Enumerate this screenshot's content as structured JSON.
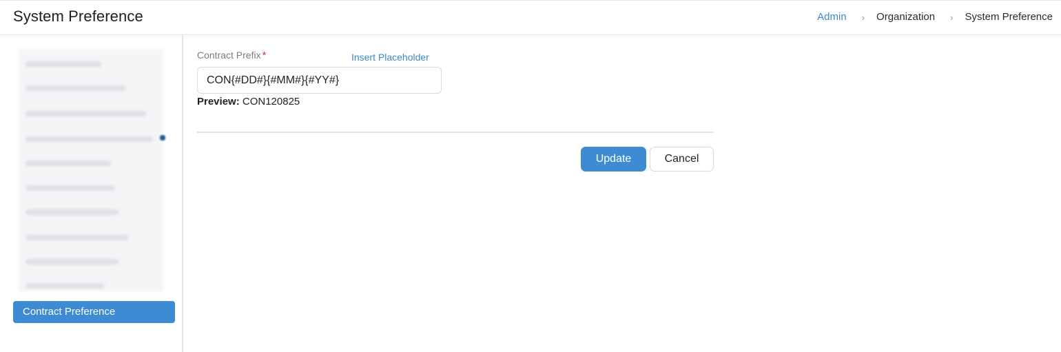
{
  "header": {
    "title": "System Preference",
    "breadcrumb": [
      {
        "label": "Admin"
      },
      {
        "label": "Organization"
      },
      {
        "label": "System Preference"
      }
    ],
    "separator": "›"
  },
  "sidebar": {
    "active_item": "Contract Preference"
  },
  "form": {
    "field_label": "Contract Prefix",
    "required_mark": "*",
    "insert_link": "Insert Placeholder",
    "prefix_value": "CON{#DD#}{#MM#}{#YY#}",
    "preview_label": "Preview:",
    "preview_value": "CON120825"
  },
  "actions": {
    "update_label": "Update",
    "cancel_label": "Cancel"
  },
  "colors": {
    "accent": "#3d8cd3",
    "link": "#3d86c6",
    "required": "#d43c3c"
  }
}
